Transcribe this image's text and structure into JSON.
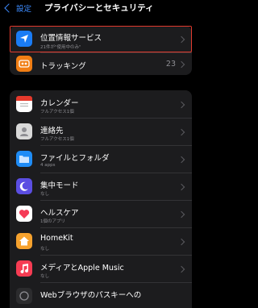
{
  "navbar": {
    "back_label": "設定",
    "title": "プライバシーとセキュリティ"
  },
  "top_group": [
    {
      "label": "位置情報サービス",
      "sub": "21件が\"使用中のみ\"",
      "value": "",
      "icon": "location-arrow-icon",
      "color": "#1a7cf5"
    },
    {
      "label": "トラッキング",
      "sub": "",
      "value": "23",
      "icon": "tracking-icon",
      "color": "#f17e14"
    }
  ],
  "apps_group": [
    {
      "label": "カレンダー",
      "sub": "フルアクセス1個",
      "icon": "calendar-icon",
      "color": "#ffffff"
    },
    {
      "label": "連絡先",
      "sub": "フルアクセス1個",
      "icon": "contacts-icon",
      "color": "#d9d9d9"
    },
    {
      "label": "ファイルとフォルダ",
      "sub": "4 apps",
      "icon": "folder-icon",
      "color": "#1f8cf5"
    },
    {
      "label": "集中モード",
      "sub": "なし",
      "icon": "moon-icon",
      "color": "#5b4ee2"
    },
    {
      "label": "ヘルスケア",
      "sub": "1個のアプリ",
      "icon": "heart-icon",
      "color": "#ffffff"
    },
    {
      "label": "HomeKit",
      "sub": "なし",
      "icon": "home-icon",
      "color": "#f6a22e"
    },
    {
      "label": "メディアとApple Music",
      "sub": "なし",
      "icon": "music-icon",
      "color": "#f63c53"
    },
    {
      "label": "Webブラウザのパスキーへの",
      "sub": "",
      "icon": "passkey-icon",
      "color": "#2c2c2e"
    }
  ]
}
